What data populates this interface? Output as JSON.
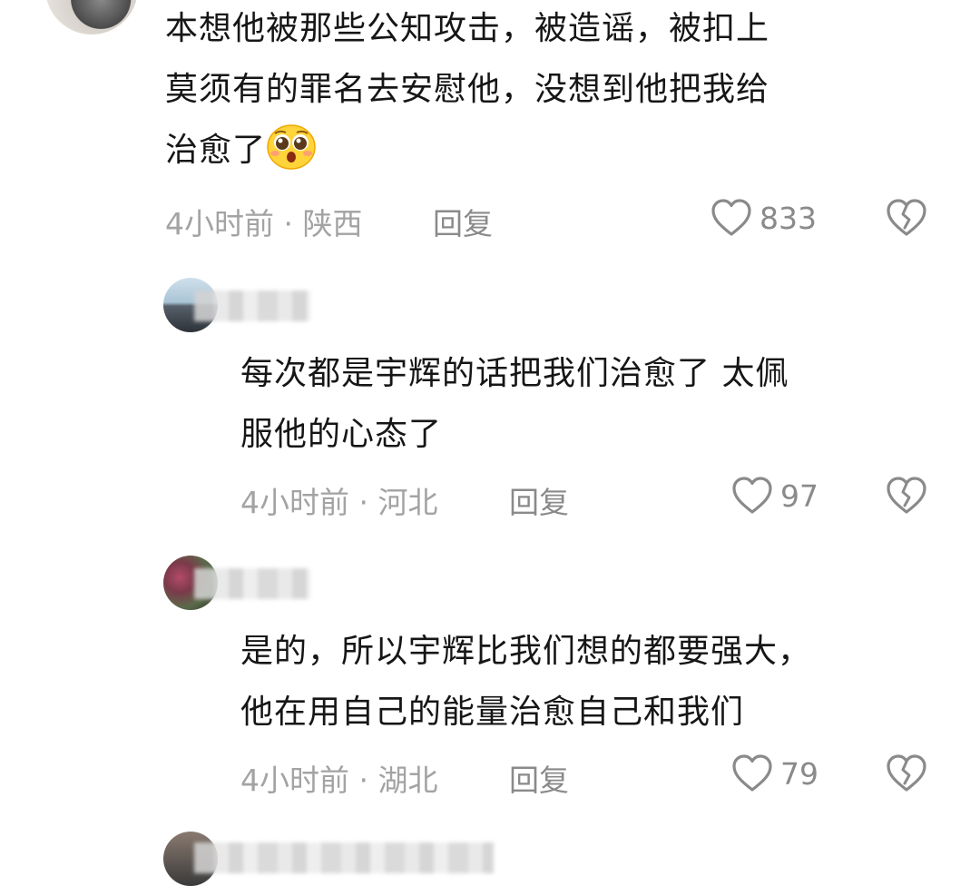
{
  "comments": [
    {
      "text_lines": [
        "本想他被那些公知攻击，被造谣，被扣上",
        "莫须有的罪名去安慰他，没想到他把我给",
        "治愈了"
      ],
      "emoji": "pleading-face-emoji",
      "time": "4小时前",
      "location": "陕西",
      "reply_label": "回复",
      "likes": "833"
    },
    {
      "text_lines": [
        "每次都是宇辉的话把我们治愈了 太佩",
        "服他的心态了"
      ],
      "time": "4小时前",
      "location": "河北",
      "reply_label": "回复",
      "likes": "97"
    },
    {
      "text_lines": [
        "是的，所以宇辉比我们想的都要强大，",
        "他在用自己的能量治愈自己和我们"
      ],
      "time": "4小时前",
      "location": "湖北",
      "reply_label": "回复",
      "likes": "79"
    }
  ],
  "meta_separator": " · ",
  "icons": {
    "like": "heart-outline-icon",
    "dislike": "broken-heart-icon"
  },
  "colors": {
    "text": "#161616",
    "meta": "#a3a3a3",
    "action": "#8a8a8a"
  }
}
